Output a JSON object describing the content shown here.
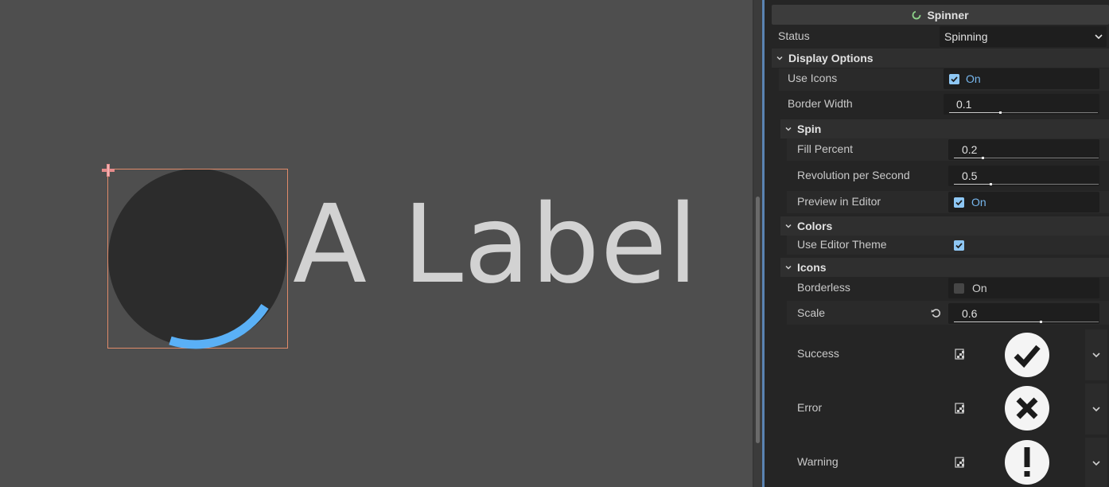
{
  "canvas": {
    "label_text": "A Label",
    "spinner_arc_color": "#5ab0f6",
    "selection_color": "#e08b6a"
  },
  "inspector": {
    "title": "Spinner",
    "status": {
      "label": "Status",
      "value": "Spinning"
    },
    "display_options": {
      "section": "Display Options",
      "use_icons": {
        "label": "Use Icons",
        "state": "On",
        "checked": true
      },
      "border_width": {
        "label": "Border Width",
        "value": "0.1",
        "fraction": 0.34
      }
    },
    "spin": {
      "section": "Spin",
      "fill_percent": {
        "label": "Fill Percent",
        "value": "0.2",
        "fraction": 0.2
      },
      "revolution_per_second": {
        "label": "Revolution per Second",
        "value": "0.5",
        "fraction": 0.25
      },
      "preview_in_editor": {
        "label": "Preview in Editor",
        "state": "On",
        "checked": true
      }
    },
    "colors": {
      "section": "Colors",
      "use_editor_theme": {
        "label": "Use Editor Theme",
        "checked": true
      }
    },
    "icons": {
      "section": "Icons",
      "borderless": {
        "label": "Borderless",
        "state": "On",
        "checked": false
      },
      "scale": {
        "label": "Scale",
        "value": "0.6",
        "fraction": 0.6
      },
      "success": {
        "label": "Success",
        "icon": "checkmark-icon"
      },
      "error": {
        "label": "Error",
        "icon": "x-icon"
      },
      "warning": {
        "label": "Warning",
        "icon": "exclamation-icon"
      }
    }
  },
  "colors": {
    "accent": "#77b7ee",
    "panel_bg": "#252525",
    "viewport_bg": "#4e4e4e"
  }
}
